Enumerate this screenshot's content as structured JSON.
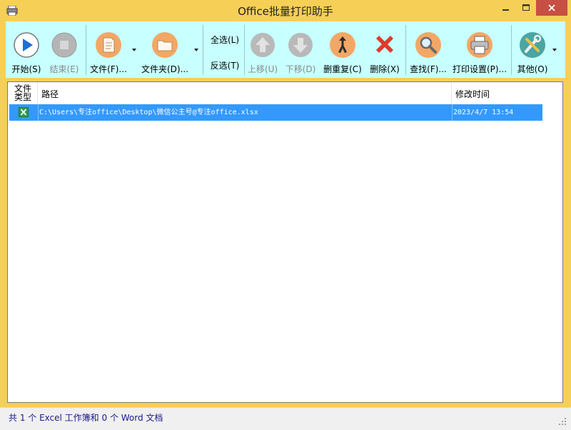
{
  "window": {
    "title": "Office批量打印助手"
  },
  "toolbar": {
    "start": "开始(S)",
    "end": "结束(E)",
    "file": "文件(F)...",
    "folder": "文件夹(D)...",
    "select_all": "全选(L)",
    "invert_select": "反选(T)",
    "move_up": "上移(U)",
    "move_down": "下移(D)",
    "remove_duplicates": "删重复(C)",
    "delete": "删除(X)",
    "find": "查找(F)...",
    "print_settings": "打印设置(P)...",
    "other": "其他(O)"
  },
  "table": {
    "headers": {
      "type": "文件类型",
      "path": "路径",
      "modified": "修改时间"
    },
    "rows": [
      {
        "type_icon": "excel-icon",
        "path": "C:\\Users\\专注office\\Desktop\\微信公主号@专注office.xlsx",
        "modified": "2023/4/7 13:54",
        "selected": true
      }
    ]
  },
  "status": {
    "text": "共 1 个 Excel 工作簿和 0 个 Word 文档"
  },
  "colors": {
    "frame": "#f6cf57",
    "toolbar": "#c8ffff",
    "selection": "#3399ff",
    "close_button": "#c74f43"
  }
}
